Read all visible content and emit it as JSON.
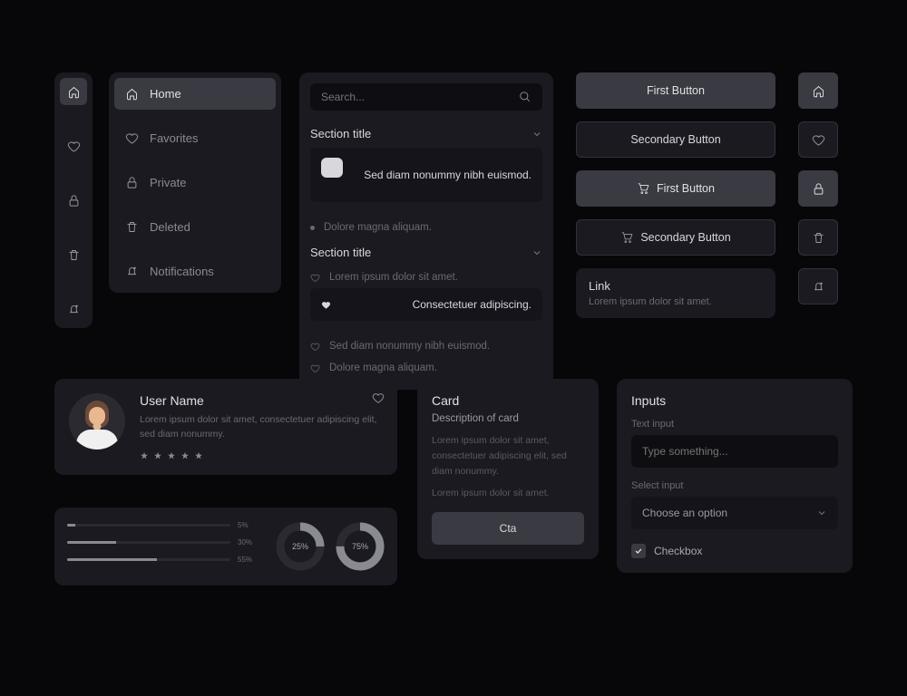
{
  "rail": [
    {
      "name": "home-icon",
      "active": true
    },
    {
      "name": "heart-icon",
      "active": false
    },
    {
      "name": "lock-icon",
      "active": false
    },
    {
      "name": "trash-icon",
      "active": false
    },
    {
      "name": "bell-icon",
      "active": false
    }
  ],
  "sidebar": {
    "items": [
      {
        "icon": "home-icon",
        "label": "Home",
        "active": true
      },
      {
        "icon": "heart-icon",
        "label": "Favorites",
        "active": false
      },
      {
        "icon": "lock-icon",
        "label": "Private",
        "active": false
      },
      {
        "icon": "trash-icon",
        "label": "Deleted",
        "active": false
      },
      {
        "icon": "bell-icon",
        "label": "Notifications",
        "active": false
      }
    ]
  },
  "list": {
    "search_placeholder": "Search...",
    "sections": [
      {
        "title": "Section title",
        "items": [
          {
            "type": "dot",
            "text": "Sed diam nonummy nibh euismod.",
            "selected": true
          },
          {
            "type": "dot",
            "text": "Dolore magna aliquam.",
            "selected": false
          }
        ]
      },
      {
        "title": "Section title",
        "items": [
          {
            "type": "heart",
            "text": "Lorem ipsum dolor sit amet.",
            "selected": false
          },
          {
            "type": "heart",
            "text": "Consectetuer adipiscing.",
            "selected": true
          },
          {
            "type": "heart",
            "text": "Sed diam nonummy nibh euismod.",
            "selected": false
          },
          {
            "type": "heart",
            "text": "Dolore magna aliquam.",
            "selected": false
          }
        ]
      }
    ]
  },
  "buttons": {
    "primary": "First Button",
    "secondary": "Secondary Button",
    "primary_cart": "First Button",
    "secondary_cart": "Secondary Button",
    "link_title": "Link",
    "link_desc": "Lorem ipsum dolor sit amet."
  },
  "user": {
    "name": "User Name",
    "desc": "Lorem ipsum dolor sit amet, consectetuer adipiscing elit, sed diam nonummy.",
    "stars": 5
  },
  "progress": {
    "bars": [
      5,
      30,
      55
    ],
    "donuts": [
      25,
      75
    ]
  },
  "card": {
    "title": "Card",
    "subtitle": "Description of card",
    "body1": "Lorem ipsum dolor sit amet, consectetuer adipiscing elit, sed diam nonummy.",
    "body2": "Lorem ipsum dolor sit amet.",
    "cta": "Cta"
  },
  "inputs": {
    "title": "Inputs",
    "text_label": "Text input",
    "text_placeholder": "Type something...",
    "select_label": "Select input",
    "select_placeholder": "Choose an option",
    "checkbox_label": "Checkbox",
    "checkbox_checked": true
  }
}
